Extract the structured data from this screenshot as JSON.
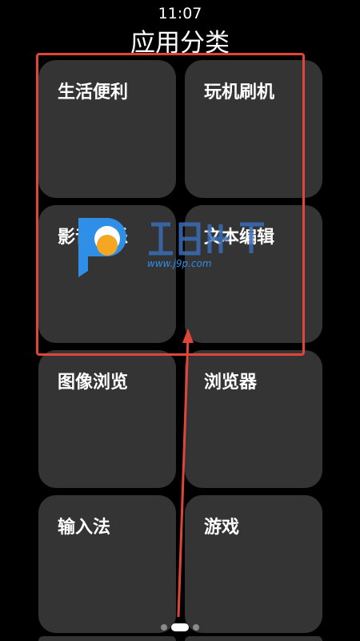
{
  "status_bar": {
    "time": "11:07"
  },
  "header": {
    "title": "应用分类"
  },
  "categories": [
    {
      "label": "生活便利"
    },
    {
      "label": "玩机刷机"
    },
    {
      "label": "影音娱乐"
    },
    {
      "label": "文本编辑"
    },
    {
      "label": "图像浏览"
    },
    {
      "label": "浏览器"
    },
    {
      "label": "输入法"
    },
    {
      "label": "游戏"
    }
  ],
  "pager": {
    "page_count": 3,
    "active_page": 2
  },
  "watermark": {
    "site": "www.j9p.com"
  },
  "colors": {
    "background": "#000000",
    "tile": "#343434",
    "annotation": "#e0453a",
    "watermark_blue": "#2f8ee6",
    "watermark_orange": "#f5a623"
  }
}
